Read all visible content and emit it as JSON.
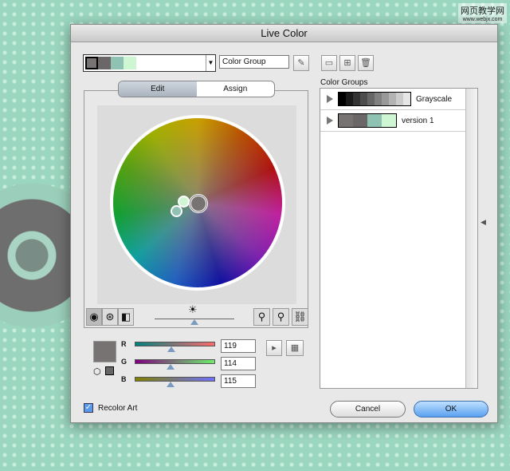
{
  "watermark": {
    "line1": "网页教学网",
    "line2": "www.webjx.com"
  },
  "dialog": {
    "title": "Live Color",
    "active_group": {
      "swatches": [
        "#777373",
        "#6b6668",
        "#8fc2b2",
        "#cff6d2"
      ]
    },
    "group_name": "Color Group",
    "tabs": [
      {
        "label": "Edit",
        "active": true
      },
      {
        "label": "Assign",
        "active": false
      }
    ],
    "color_groups_label": "Color Groups",
    "groups": [
      {
        "name": "Grayscale",
        "swatches": [
          "#000",
          "#1a1a1a",
          "#333",
          "#4d4d4d",
          "#666",
          "#808080",
          "#999",
          "#b3b3b3",
          "#ccc",
          "#e6e6e6"
        ]
      },
      {
        "name": "version 1",
        "swatches": [
          "#777373",
          "#6b6668",
          "#8fc2b2",
          "#cff6d2"
        ]
      }
    ],
    "sliders": [
      {
        "label": "R",
        "value": "119",
        "fraction": 0.47
      },
      {
        "label": "G",
        "value": "114",
        "fraction": 0.45
      },
      {
        "label": "B",
        "value": "115",
        "fraction": 0.45
      }
    ],
    "brightness_fraction": 0.55,
    "recolor_art": {
      "label": "Recolor Art",
      "checked": true
    },
    "cancel": "Cancel",
    "ok": "OK"
  }
}
